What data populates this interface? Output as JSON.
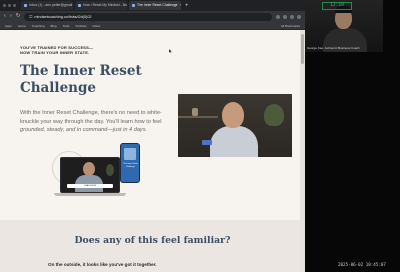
{
  "browser": {
    "tabs": [
      {
        "label": "Inbox (1) - ann.petter@gmail",
        "active": false
      },
      {
        "label": "How I Reset My Mindset - Bui",
        "active": false
      },
      {
        "label": "The Inner Reset Challenge",
        "active": true
      }
    ],
    "url": "mindsetcoaching.co/links/i2d(0)02",
    "bookmarks": [
      "Apps",
      "Home",
      "Coaching",
      "Blog",
      "Tools",
      "Podcast",
      "Notes"
    ],
    "bookmarks_right": "All Bookmarks"
  },
  "page": {
    "kicker_line1": "YOU'VE TRAINED FOR SUCCESS—",
    "kicker_line2": "NOW TRAIN YOUR INNER STATE.",
    "title": "The Inner Reset Challenge",
    "desc_plain": "With the Inner Reset Challenge, there's no need to white-knuckle your way through the day. You'll learn how to feel ",
    "desc_em": "grounded, steady, and in command—just in 4 days.",
    "laptop_caption": "CHALLENGE",
    "phone_text": "The Inner Reset Challenge",
    "familiar_title": "Does any of this feel familiar?",
    "familiar_sub": "On the outside, it looks like you've got it together."
  },
  "side": {
    "time": "12:19",
    "cam_label": "George Kao, Authentic Business Coach",
    "timestamp": "2025-06-02 10:45:07"
  },
  "colors": {
    "title_navy": "#3d4d63",
    "page_bg": "#f7f3ef",
    "section_bg": "#ebe6e1",
    "timer_green": "#2ecc71"
  }
}
